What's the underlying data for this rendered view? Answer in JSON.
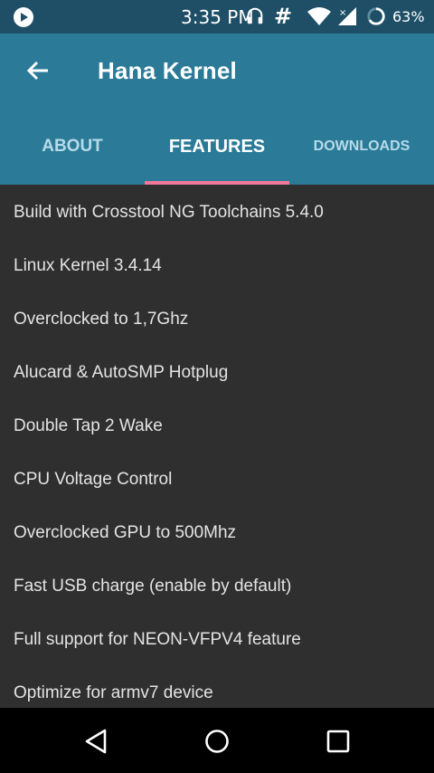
{
  "status_bar": {
    "time": "3:35 PM",
    "hash_symbol": "#",
    "battery_percent": "63%",
    "icons": [
      "play-icon",
      "headset-icon",
      "wifi-icon",
      "signal-icon",
      "battery-icon"
    ]
  },
  "app_bar": {
    "title": "Hana Kernel",
    "back_icon": "arrow-left-icon"
  },
  "tabs": [
    {
      "label": "ABOUT",
      "selected": false
    },
    {
      "label": "FEATURES",
      "selected": true
    },
    {
      "label": "DOWNLOADS",
      "selected": false
    }
  ],
  "features": [
    "Build with Crosstool NG Toolchains 5.4.0",
    "Linux Kernel 3.4.14",
    "Overclocked to 1,7Ghz",
    "Alucard & AutoSMP Hotplug",
    "Double Tap 2 Wake",
    "CPU Voltage Control",
    "Overclocked GPU to 500Mhz",
    "Fast USB charge (enable by default)",
    "Full support for NEON-VFPV4 feature",
    "Optimize for armv7 device"
  ],
  "nav_bar": {
    "icons": [
      "back-triangle-icon",
      "home-circle-icon",
      "recents-square-icon"
    ]
  },
  "colors": {
    "status_bar": "#1f4f66",
    "primary": "#2a7a98",
    "accent": "#f2789a",
    "background": "#2f2f2f"
  }
}
